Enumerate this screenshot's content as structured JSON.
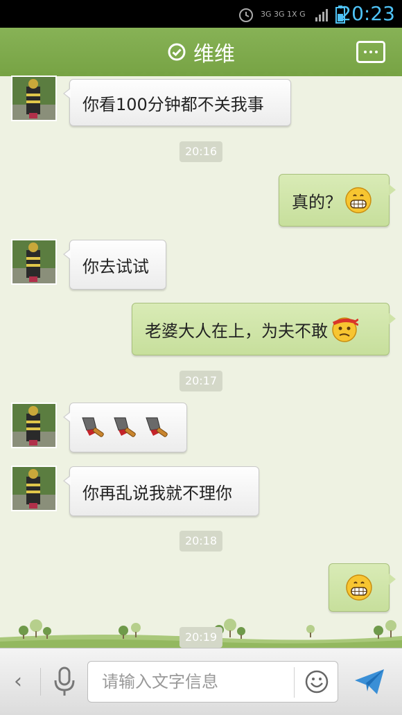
{
  "status": {
    "time": "20:23",
    "network": "3G 3G 1X G"
  },
  "header": {
    "title": "维维"
  },
  "messages": {
    "m1": {
      "text": "你看100分钟都不关我事"
    },
    "t1": {
      "text": "20:16"
    },
    "m2": {
      "text": "真的？"
    },
    "m3": {
      "text": "你去试试"
    },
    "m4": {
      "text": "老婆大人在上，为夫不敢"
    },
    "t2": {
      "text": "20:17"
    },
    "m6": {
      "text": "你再乱说我就不理你"
    },
    "t3": {
      "text": "20:18"
    },
    "t4": {
      "text": "20:19"
    }
  },
  "input": {
    "placeholder": "请输入文字信息"
  },
  "icons": {
    "verified": "check-circle-icon",
    "more": "more-dots-icon",
    "back": "chevron-left-icon",
    "mic": "microphone-icon",
    "emoji": "smiley-icon",
    "send": "paper-plane-icon"
  },
  "colors": {
    "header": "#7da84a",
    "sent_bubble": "#cfe3a8",
    "received_bubble": "#f6f6f6",
    "time": "#4fc3f7"
  }
}
